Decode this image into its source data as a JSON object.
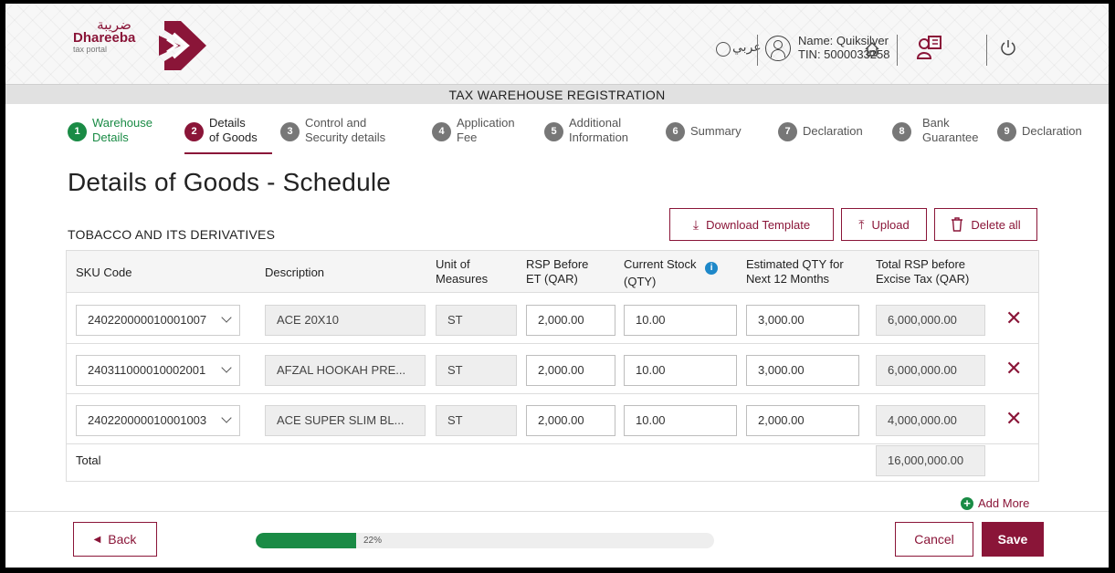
{
  "brand": {
    "name_ar": "ضريبة",
    "name_en": "Dhareeba",
    "tagline": "tax portal",
    "color": "#8a1538"
  },
  "header": {
    "language": "عربي",
    "user_name": "Name: Quiksilver",
    "tin": "TIN: 5000033258",
    "icons": [
      "globe-icon",
      "user-icon",
      "home-icon",
      "bookmark-icon",
      "power-icon"
    ]
  },
  "page_banner": "TAX WAREHOUSE REGISTRATION",
  "steps": [
    {
      "num": "1",
      "label_1": "Warehouse",
      "label_2": "Details",
      "state": "done"
    },
    {
      "num": "2",
      "label_1": "Details",
      "label_2": "of Goods",
      "state": "active"
    },
    {
      "num": "3",
      "label_1": "Control and",
      "label_2": "Security details",
      "state": "pending"
    },
    {
      "num": "4",
      "label_1": "Application",
      "label_2": "Fee",
      "state": "pending"
    },
    {
      "num": "5",
      "label_1": "Additional",
      "label_2": "Information",
      "state": "pending"
    },
    {
      "num": "6",
      "label_1": "Summary",
      "label_2": "",
      "state": "pending"
    },
    {
      "num": "7",
      "label_1": "Declaration",
      "label_2": "",
      "state": "pending"
    },
    {
      "num": "8",
      "label_1": "Bank",
      "label_2": "Guarantee",
      "state": "pending"
    },
    {
      "num": "9",
      "label_1": "Declaration",
      "label_2": "",
      "state": "pending"
    }
  ],
  "page_title": "Details of Goods - Schedule",
  "section_label": "TOBACCO AND ITS DERIVATIVES",
  "actions": {
    "download_template": "Download Template",
    "upload": "Upload",
    "delete_all": "Delete all"
  },
  "table": {
    "columns": {
      "sku": "SKU Code",
      "desc": "Description",
      "uom_1": "Unit of",
      "uom_2": "Measures",
      "rsp_1": "RSP Before",
      "rsp_2": "ET (QAR)",
      "stock_1": "Current Stock",
      "stock_2": "(QTY)",
      "est_1": "Estimated QTY for",
      "est_2": "Next 12 Months",
      "total_1": "Total RSP before",
      "total_2": "Excise Tax (QAR)"
    },
    "rows": [
      {
        "sku": "240220000010001007",
        "desc": "ACE 20X10",
        "uom": "ST",
        "rsp": "2,000.00",
        "stock": "10.00",
        "est": "3,000.00",
        "total": "6,000,000.00"
      },
      {
        "sku": "240311000010002001",
        "desc": "AFZAL HOOKAH PRE...",
        "uom": "ST",
        "rsp": "2,000.00",
        "stock": "10.00",
        "est": "3,000.00",
        "total": "6,000,000.00"
      },
      {
        "sku": "240220000010001003",
        "desc": "ACE SUPER SLIM BL...",
        "uom": "ST",
        "rsp": "2,000.00",
        "stock": "10.00",
        "est": "2,000.00",
        "total": "4,000,000.00"
      }
    ],
    "total_label": "Total",
    "total_value": "16,000,000.00",
    "delete_glyph": "✕"
  },
  "add_more": "Add More",
  "footer": {
    "back": "Back",
    "progress_text": "22%",
    "progress_value": 0.22,
    "cancel": "Cancel",
    "save": "Save"
  }
}
